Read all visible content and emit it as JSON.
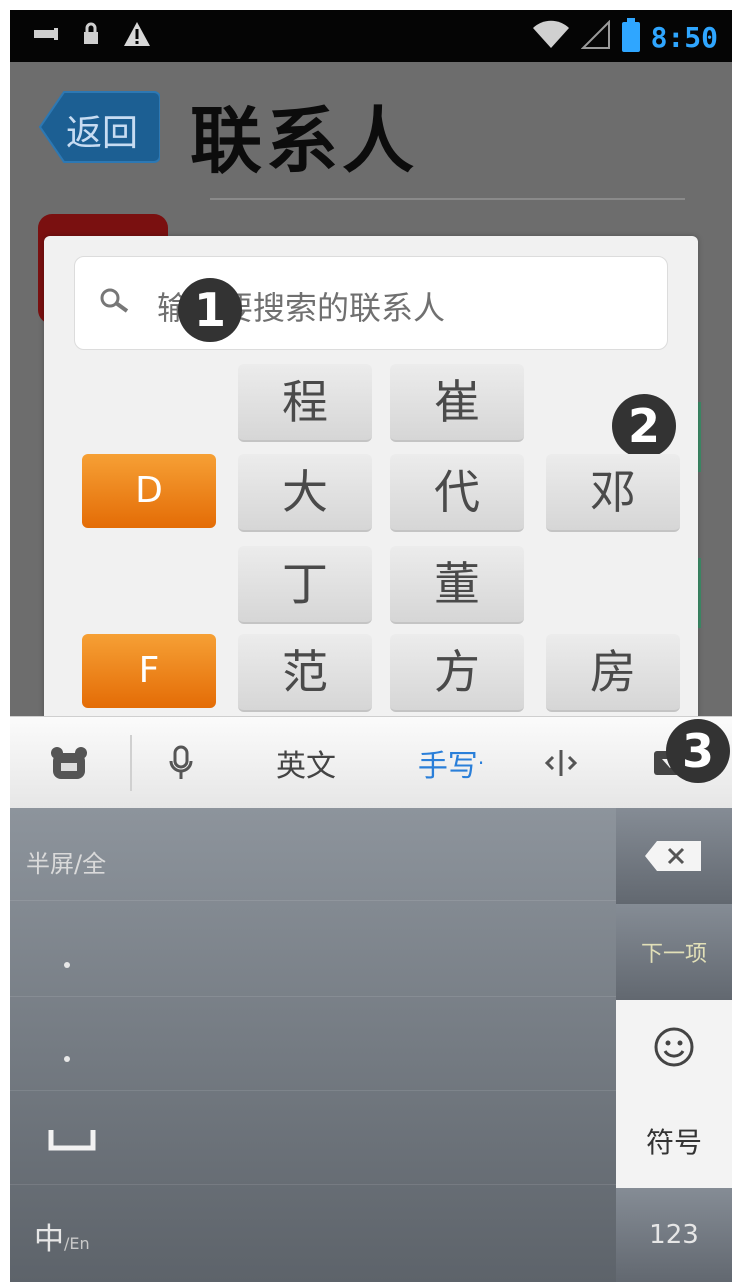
{
  "status_bar": {
    "time": "8:50",
    "icons": [
      "usb-icon",
      "lock-icon",
      "warning-icon",
      "wifi-icon",
      "signal-icon",
      "battery-icon"
    ]
  },
  "header": {
    "back_label": "返回",
    "title": "联系人"
  },
  "search": {
    "placeholder": "输入要搜索的联系人"
  },
  "badges": [
    "1",
    "2",
    "3"
  ],
  "index_groups": [
    {
      "letter": "",
      "names": [
        "程",
        "崔"
      ]
    },
    {
      "letter": "D",
      "names": [
        "大",
        "代",
        "邓"
      ]
    },
    {
      "letter": "",
      "names": [
        "丁",
        "董"
      ]
    },
    {
      "letter": "F",
      "names": [
        "范",
        "方",
        "房"
      ]
    }
  ],
  "ime_toolbar": {
    "items": [
      "pet-icon",
      "mic-icon",
      "英文",
      "手写",
      "cursor-icon",
      "collapse-icon"
    ],
    "english_label": "英文",
    "handwriting_label": "手写",
    "handwriting_marker": "·"
  },
  "keyboard": {
    "hint": "半屏/全",
    "lang_label": "中",
    "lang_sub": "/En",
    "next_label": "下一项",
    "symbol_label": "符号",
    "numeric_label": "123"
  },
  "colors": {
    "accent_orange": "#f08a1c",
    "back_button": "#1c5f93",
    "time_blue": "#2fa6ff",
    "handwriting_blue": "#2a7fd9",
    "status_bar": "#050505"
  }
}
